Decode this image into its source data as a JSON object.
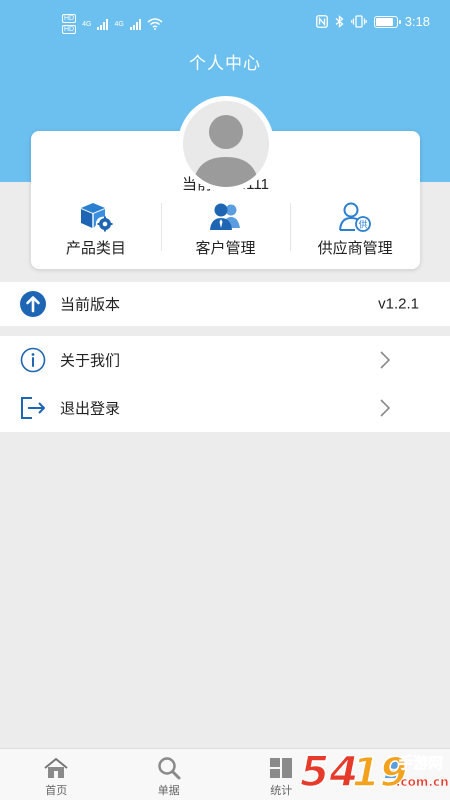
{
  "status_bar": {
    "net_badge_1": "HD",
    "net_badge_2": "HD",
    "signal_label_1": "4G",
    "signal_label_2": "4G",
    "time": "3:18",
    "battery_level": 0.9
  },
  "header": {
    "title": "个人中心"
  },
  "profile": {
    "username_text": "当前用户:111"
  },
  "shortcuts": [
    {
      "label": "产品类目",
      "icon": "cube-gear-icon"
    },
    {
      "label": "客户管理",
      "icon": "customers-icon"
    },
    {
      "label": "供应商管理",
      "icon": "supplier-icon"
    }
  ],
  "version": {
    "label": "当前版本",
    "value": "v1.2.1"
  },
  "menu": {
    "about": {
      "label": "关于我们"
    },
    "logout": {
      "label": "退出登录"
    }
  },
  "tabbar": {
    "items": [
      {
        "label": "首页",
        "icon": "home-icon"
      },
      {
        "label": "单据",
        "icon": "search-icon"
      },
      {
        "label": "统计",
        "icon": "stats-icon"
      },
      {
        "label": "",
        "icon": "mine-icon"
      }
    ]
  },
  "watermark": {
    "text_main": "5419",
    "text_cn": "手游网",
    "text_url": ".com.cn"
  },
  "colors": {
    "header_bg": "#6cc0ef",
    "accent_blue": "#1e78c8",
    "page_bg": "#ececec"
  }
}
